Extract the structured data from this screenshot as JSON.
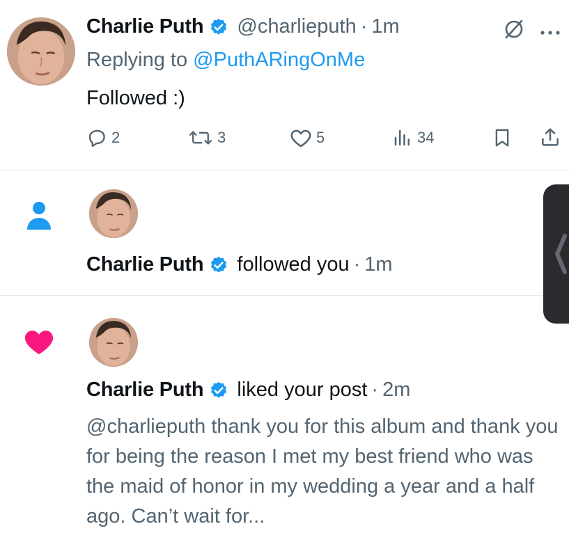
{
  "notification_1": {
    "author_name": "Charlie Puth",
    "handle": "@charlieputh",
    "separator": "·",
    "time": "1m",
    "replying_prefix": "Replying to",
    "replying_handle": "@PuthARingOnMe",
    "body": "Followed :)",
    "actions": {
      "reply_count": "2",
      "retweet_count": "3",
      "like_count": "5",
      "views_count": "34"
    },
    "icons": [
      "grok-icon",
      "more-icon",
      "reply-icon",
      "retweet-icon",
      "like-icon",
      "views-icon",
      "bookmark-icon",
      "share-icon"
    ]
  },
  "notification_2": {
    "type_icon": "person-icon",
    "author_name": "Charlie Puth",
    "action_text": "followed you",
    "separator": "·",
    "time": "1m"
  },
  "notification_3": {
    "type_icon": "heart-icon",
    "author_name": "Charlie Puth",
    "action_text": "liked your post",
    "separator": "·",
    "time": "2m",
    "post_text": "@charlieputh thank you for this album and thank you for being the reason I met my best friend who was the maid of honor in my wedding a year and a half ago. Can’t wait for..."
  },
  "colors": {
    "accent_blue": "#1d9bf0",
    "muted_gray": "#536471",
    "like_pink": "#f91880",
    "verified_blue": "#1d9bf0"
  }
}
